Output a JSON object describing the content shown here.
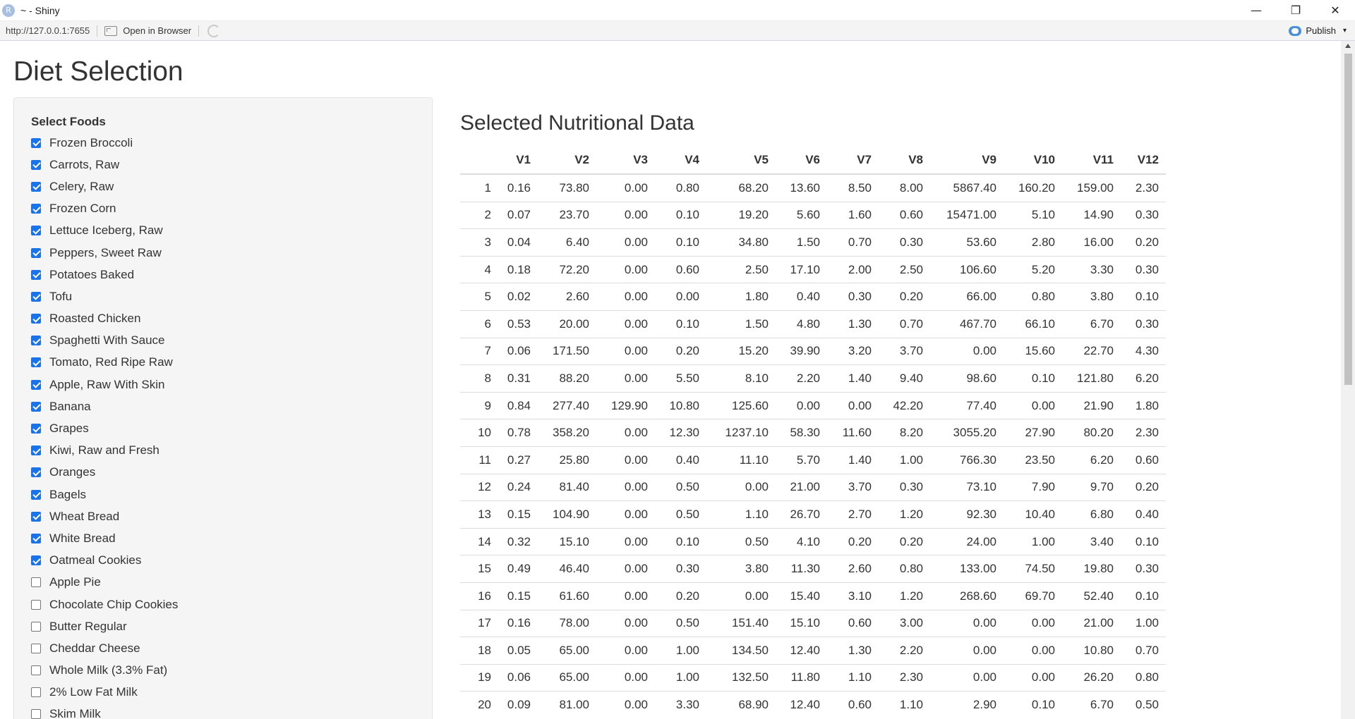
{
  "window": {
    "title": "~ - Shiny",
    "app_icon": "R",
    "controls": {
      "minimize": "—",
      "restore": "❐",
      "close": "✕"
    }
  },
  "toolbar": {
    "url": "http://127.0.0.1:7655",
    "open_in_browser": "Open in Browser",
    "publish": "Publish"
  },
  "page": {
    "title": "Diet Selection"
  },
  "sidebar": {
    "label": "Select Foods",
    "foods": [
      {
        "label": "Frozen Broccoli",
        "checked": true
      },
      {
        "label": "Carrots, Raw",
        "checked": true
      },
      {
        "label": "Celery, Raw",
        "checked": true
      },
      {
        "label": "Frozen Corn",
        "checked": true
      },
      {
        "label": "Lettuce Iceberg, Raw",
        "checked": true
      },
      {
        "label": "Peppers, Sweet Raw",
        "checked": true
      },
      {
        "label": "Potatoes Baked",
        "checked": true
      },
      {
        "label": "Tofu",
        "checked": true
      },
      {
        "label": "Roasted Chicken",
        "checked": true
      },
      {
        "label": "Spaghetti With Sauce",
        "checked": true
      },
      {
        "label": "Tomato, Red Ripe Raw",
        "checked": true
      },
      {
        "label": "Apple, Raw With Skin",
        "checked": true
      },
      {
        "label": "Banana",
        "checked": true
      },
      {
        "label": "Grapes",
        "checked": true
      },
      {
        "label": "Kiwi, Raw and Fresh",
        "checked": true
      },
      {
        "label": "Oranges",
        "checked": true
      },
      {
        "label": "Bagels",
        "checked": true
      },
      {
        "label": "Wheat Bread",
        "checked": true
      },
      {
        "label": "White Bread",
        "checked": true
      },
      {
        "label": "Oatmeal Cookies",
        "checked": true
      },
      {
        "label": "Apple Pie",
        "checked": false
      },
      {
        "label": "Chocolate Chip Cookies",
        "checked": false
      },
      {
        "label": "Butter Regular",
        "checked": false
      },
      {
        "label": "Cheddar Cheese",
        "checked": false
      },
      {
        "label": "Whole Milk (3.3% Fat)",
        "checked": false
      },
      {
        "label": "2% Low Fat Milk",
        "checked": false
      },
      {
        "label": "Skim Milk",
        "checked": false
      }
    ]
  },
  "main": {
    "title": "Selected Nutritional Data",
    "columns": [
      "",
      "V1",
      "V2",
      "V3",
      "V4",
      "V5",
      "V6",
      "V7",
      "V8",
      "V9",
      "V10",
      "V11",
      "V12"
    ],
    "rows": [
      [
        "1",
        "0.16",
        "73.80",
        "0.00",
        "0.80",
        "68.20",
        "13.60",
        "8.50",
        "8.00",
        "5867.40",
        "160.20",
        "159.00",
        "2.30"
      ],
      [
        "2",
        "0.07",
        "23.70",
        "0.00",
        "0.10",
        "19.20",
        "5.60",
        "1.60",
        "0.60",
        "15471.00",
        "5.10",
        "14.90",
        "0.30"
      ],
      [
        "3",
        "0.04",
        "6.40",
        "0.00",
        "0.10",
        "34.80",
        "1.50",
        "0.70",
        "0.30",
        "53.60",
        "2.80",
        "16.00",
        "0.20"
      ],
      [
        "4",
        "0.18",
        "72.20",
        "0.00",
        "0.60",
        "2.50",
        "17.10",
        "2.00",
        "2.50",
        "106.60",
        "5.20",
        "3.30",
        "0.30"
      ],
      [
        "5",
        "0.02",
        "2.60",
        "0.00",
        "0.00",
        "1.80",
        "0.40",
        "0.30",
        "0.20",
        "66.00",
        "0.80",
        "3.80",
        "0.10"
      ],
      [
        "6",
        "0.53",
        "20.00",
        "0.00",
        "0.10",
        "1.50",
        "4.80",
        "1.30",
        "0.70",
        "467.70",
        "66.10",
        "6.70",
        "0.30"
      ],
      [
        "7",
        "0.06",
        "171.50",
        "0.00",
        "0.20",
        "15.20",
        "39.90",
        "3.20",
        "3.70",
        "0.00",
        "15.60",
        "22.70",
        "4.30"
      ],
      [
        "8",
        "0.31",
        "88.20",
        "0.00",
        "5.50",
        "8.10",
        "2.20",
        "1.40",
        "9.40",
        "98.60",
        "0.10",
        "121.80",
        "6.20"
      ],
      [
        "9",
        "0.84",
        "277.40",
        "129.90",
        "10.80",
        "125.60",
        "0.00",
        "0.00",
        "42.20",
        "77.40",
        "0.00",
        "21.90",
        "1.80"
      ],
      [
        "10",
        "0.78",
        "358.20",
        "0.00",
        "12.30",
        "1237.10",
        "58.30",
        "11.60",
        "8.20",
        "3055.20",
        "27.90",
        "80.20",
        "2.30"
      ],
      [
        "11",
        "0.27",
        "25.80",
        "0.00",
        "0.40",
        "11.10",
        "5.70",
        "1.40",
        "1.00",
        "766.30",
        "23.50",
        "6.20",
        "0.60"
      ],
      [
        "12",
        "0.24",
        "81.40",
        "0.00",
        "0.50",
        "0.00",
        "21.00",
        "3.70",
        "0.30",
        "73.10",
        "7.90",
        "9.70",
        "0.20"
      ],
      [
        "13",
        "0.15",
        "104.90",
        "0.00",
        "0.50",
        "1.10",
        "26.70",
        "2.70",
        "1.20",
        "92.30",
        "10.40",
        "6.80",
        "0.40"
      ],
      [
        "14",
        "0.32",
        "15.10",
        "0.00",
        "0.10",
        "0.50",
        "4.10",
        "0.20",
        "0.20",
        "24.00",
        "1.00",
        "3.40",
        "0.10"
      ],
      [
        "15",
        "0.49",
        "46.40",
        "0.00",
        "0.30",
        "3.80",
        "11.30",
        "2.60",
        "0.80",
        "133.00",
        "74.50",
        "19.80",
        "0.30"
      ],
      [
        "16",
        "0.15",
        "61.60",
        "0.00",
        "0.20",
        "0.00",
        "15.40",
        "3.10",
        "1.20",
        "268.60",
        "69.70",
        "52.40",
        "0.10"
      ],
      [
        "17",
        "0.16",
        "78.00",
        "0.00",
        "0.50",
        "151.40",
        "15.10",
        "0.60",
        "3.00",
        "0.00",
        "0.00",
        "21.00",
        "1.00"
      ],
      [
        "18",
        "0.05",
        "65.00",
        "0.00",
        "1.00",
        "134.50",
        "12.40",
        "1.30",
        "2.20",
        "0.00",
        "0.00",
        "10.80",
        "0.70"
      ],
      [
        "19",
        "0.06",
        "65.00",
        "0.00",
        "1.00",
        "132.50",
        "11.80",
        "1.10",
        "2.30",
        "0.00",
        "0.00",
        "26.20",
        "0.80"
      ],
      [
        "20",
        "0.09",
        "81.00",
        "0.00",
        "3.30",
        "68.90",
        "12.40",
        "0.60",
        "1.10",
        "2.90",
        "0.10",
        "6.70",
        "0.50"
      ]
    ]
  },
  "colors": {
    "checkbox_accent": "#1a73e8",
    "sidebar_bg": "#f5f5f5",
    "publish_icon": "#4a90d9"
  }
}
